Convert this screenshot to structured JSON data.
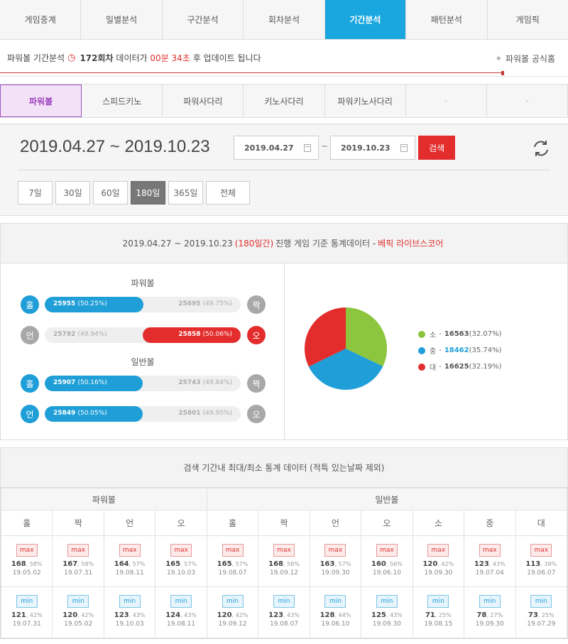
{
  "nav": {
    "tabs": [
      "게임중계",
      "일별분석",
      "구간분석",
      "회차분석",
      "기간분석",
      "패턴분석",
      "게임픽"
    ],
    "active_index": 4
  },
  "info": {
    "prefix": "파워볼 기간분석",
    "round": "172회차",
    "mid": "데이터가",
    "countdown": "00분 34초",
    "suffix": "후 업데이트 됩니다",
    "official_link": "파워볼 공식홈"
  },
  "games": {
    "tabs": [
      "파워볼",
      "스피드키노",
      "파워사다리",
      "키노사다리",
      "파워키노사다리",
      "-",
      "-"
    ],
    "active_index": 0
  },
  "range": {
    "title": "2019.04.27 ~ 2019.10.23",
    "start": "2019.04.27",
    "tilde": "~",
    "end": "2019.10.23",
    "search_label": "검색",
    "periods": [
      "7일",
      "30일",
      "60일",
      "180일",
      "365일",
      "전체"
    ],
    "active_period": 3
  },
  "stats": {
    "header_prefix": "2019.04.27 ~ 2019.10.23",
    "header_days": "(180일간)",
    "header_mid": "진행 게임 기준 통계데이터 -",
    "header_source": "베픽 라이브스코어",
    "powerball_label": "파워볼",
    "normal_label": "일반볼",
    "rows": [
      {
        "left": "홀",
        "right": "짝",
        "left_val": "25955",
        "left_pct": "(50.25%)",
        "right_val": "25695",
        "right_pct": "(49.75%)",
        "winner": "left",
        "fill_pct": 50.25
      },
      {
        "left": "언",
        "right": "오",
        "left_val": "25792",
        "left_pct": "(49.94%)",
        "right_val": "25858",
        "right_pct": "(50.06%)",
        "winner": "right",
        "fill_pct": 50.06
      },
      {
        "left": "홀",
        "right": "짝",
        "left_val": "25907",
        "left_pct": "(50.16%)",
        "right_val": "25743",
        "right_pct": "(49.84%)",
        "winner": "left",
        "fill_pct": 50.16
      },
      {
        "left": "언",
        "right": "오",
        "left_val": "25849",
        "left_pct": "(50.05%)",
        "right_val": "25801",
        "right_pct": "(49.95%)",
        "winner": "left",
        "fill_pct": 50.05
      }
    ],
    "pie": [
      {
        "label": "소",
        "value": "16563",
        "pct": "(32.07%)",
        "color": "#8cc63f",
        "share": 32.07
      },
      {
        "label": "중",
        "value": "18462",
        "pct": "(35.74%)",
        "color": "#1f9ed8",
        "share": 35.74
      },
      {
        "label": "대",
        "value": "16625",
        "pct": "(32.19%)",
        "color": "#e32d2d",
        "share": 32.19
      }
    ],
    "dash": "-"
  },
  "maxmin": {
    "header": "검색 기간내 최대/최소 통계 데이터 (적특 있는날짜 제외)",
    "groups": [
      "파워볼",
      "일반볼"
    ],
    "columns": [
      "홀",
      "짝",
      "언",
      "오",
      "홀",
      "짝",
      "언",
      "오",
      "소",
      "중",
      "대"
    ],
    "max_tag": "max",
    "min_tag": "min",
    "max": [
      {
        "v": "168",
        "p": ", 58%",
        "d": "19.05.02"
      },
      {
        "v": "167",
        "p": ", 58%",
        "d": "19.07.31"
      },
      {
        "v": "164",
        "p": ", 57%",
        "d": "19.08.11"
      },
      {
        "v": "165",
        "p": ", 57%",
        "d": "19.10.03"
      },
      {
        "v": "165",
        "p": ", 57%",
        "d": "19.08.07"
      },
      {
        "v": "168",
        "p": ", 58%",
        "d": "19.09.12"
      },
      {
        "v": "163",
        "p": ", 57%",
        "d": "19.09.30"
      },
      {
        "v": "160",
        "p": ", 56%",
        "d": "19.06.10"
      },
      {
        "v": "120",
        "p": ", 42%",
        "d": "19.09.30"
      },
      {
        "v": "123",
        "p": ", 43%",
        "d": "19.07.04"
      },
      {
        "v": "113",
        "p": ", 39%",
        "d": "19.06.07"
      }
    ],
    "min": [
      {
        "v": "121",
        "p": ", 42%",
        "d": "19.07.31"
      },
      {
        "v": "120",
        "p": ", 42%",
        "d": "19.05.02"
      },
      {
        "v": "123",
        "p": ", 43%",
        "d": "19.10.03"
      },
      {
        "v": "124",
        "p": ", 43%",
        "d": "19.08.11"
      },
      {
        "v": "120",
        "p": ", 42%",
        "d": "19.09.12"
      },
      {
        "v": "123",
        "p": ", 43%",
        "d": "19.08.07"
      },
      {
        "v": "128",
        "p": ", 44%",
        "d": "19.06.10"
      },
      {
        "v": "125",
        "p": ", 43%",
        "d": "19.09.30"
      },
      {
        "v": "71",
        "p": ", 25%",
        "d": "19.08.15"
      },
      {
        "v": "78",
        "p": ", 27%",
        "d": "19.09.30"
      },
      {
        "v": "73",
        "p": ", 25%",
        "d": "19.07.29"
      }
    ]
  }
}
